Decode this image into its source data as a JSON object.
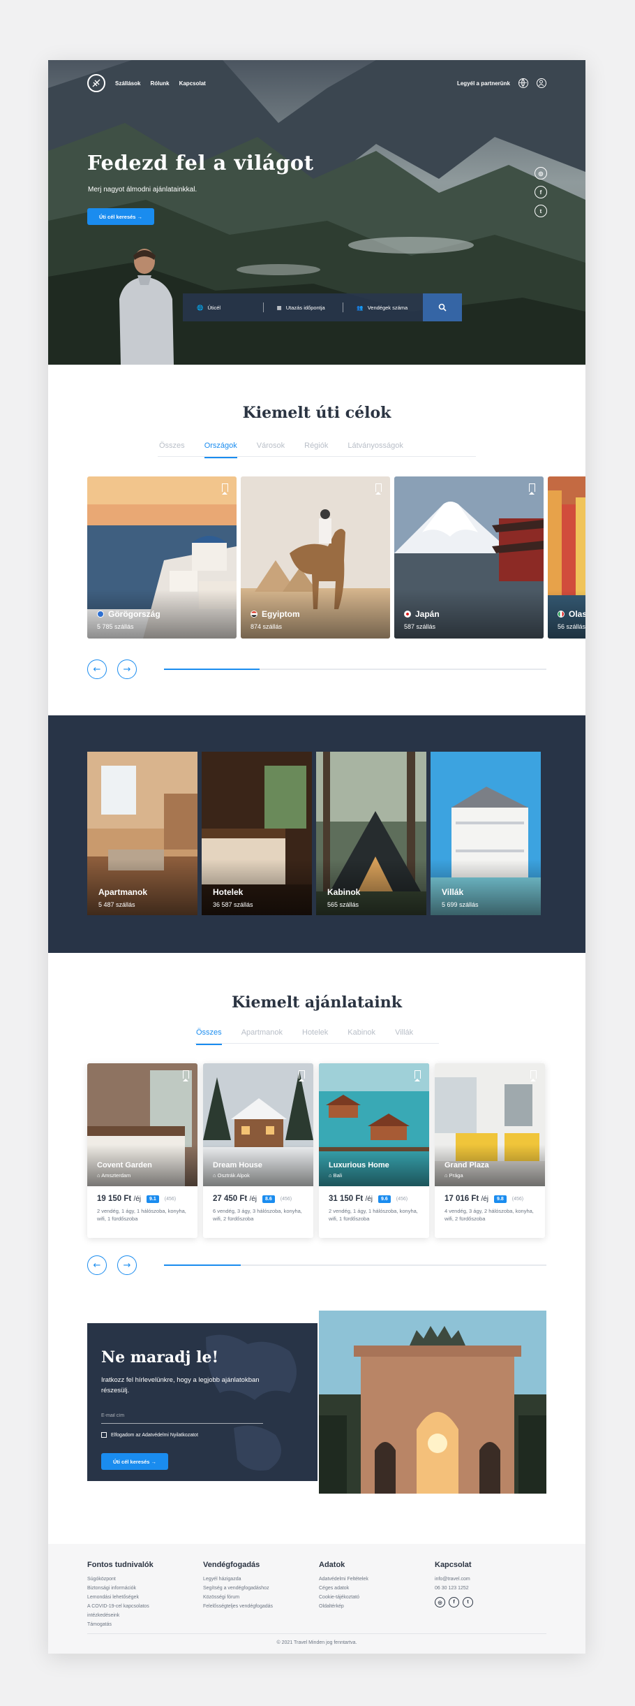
{
  "nav": {
    "links": [
      "Szállások",
      "Rólunk",
      "Kapcsolat"
    ],
    "partner": "Legyél a partnerünk"
  },
  "hero": {
    "title": "Fedezd fel a világot",
    "subtitle": "Merj nagyot álmodni ajánlatainkkal.",
    "cta": "Úti cél keresés →",
    "social": [
      "instagram-icon",
      "facebook-icon",
      "twitter-icon"
    ]
  },
  "search": {
    "destination": "Úticél",
    "dates": "Utazás időpontja",
    "guests": "Vendégek száma"
  },
  "destinations": {
    "title": "Kiemelt úti célok",
    "tabs": [
      "Összes",
      "Országok",
      "Városok",
      "Régiók",
      "Látványosságok"
    ],
    "active_tab": "Országok",
    "progress": 0.25,
    "cards": [
      {
        "name": "Görögország",
        "count": "5 785 szállás"
      },
      {
        "name": "Egyiptom",
        "count": "874 szállás"
      },
      {
        "name": "Japán",
        "count": "587 szállás"
      },
      {
        "name": "Olasz",
        "count": "56 szállás"
      }
    ]
  },
  "categories": [
    {
      "name": "Apartmanok",
      "count": "5 487 szállás"
    },
    {
      "name": "Hotelek",
      "count": "36 587 szállás"
    },
    {
      "name": "Kabinok",
      "count": "565 szállás"
    },
    {
      "name": "Villák",
      "count": "5 699 szállás"
    }
  ],
  "offers": {
    "title": "Kiemelt ajánlataink",
    "tabs": [
      "Összes",
      "Apartmanok",
      "Hotelek",
      "Kabinok",
      "Villák"
    ],
    "active_tab": "Összes",
    "progress": 0.25,
    "cards": [
      {
        "name": "Covent Garden",
        "location": "Amszterdam",
        "price": "19 150 Ft",
        "per": "/éj",
        "rating": "9.1",
        "reviews": "(456)",
        "desc": "2 vendég, 1 ágy, 1 hálószoba, konyha, wifi, 1 fürdőszoba"
      },
      {
        "name": "Dream House",
        "location": "Osztrák Alpok",
        "price": "27 450 Ft",
        "per": "/éj",
        "rating": "8.6",
        "reviews": "(456)",
        "desc": "6 vendég, 3 ágy, 3 hálószoba, konyha, wifi, 2 fürdőszoba"
      },
      {
        "name": "Luxurious Home",
        "location": "Bali",
        "price": "31 150 Ft",
        "per": "/éj",
        "rating": "9.6",
        "reviews": "(456)",
        "desc": "2 vendég, 1 ágy, 1 hálószoba, konyha, wifi, 1 fürdőszoba"
      },
      {
        "name": "Grand Plaza",
        "location": "Prága",
        "price": "17 016 Ft",
        "per": "/éj",
        "rating": "9.8",
        "reviews": "(456)",
        "desc": "4 vendég, 3 ágy, 2 hálószoba, konyha, wifi, 2 fürdőszoba"
      }
    ]
  },
  "newsletter": {
    "title": "Ne maradj le!",
    "subtitle": "Iratkozz fel hírlevelünkre, hogy a legjobb ajánlatokban részesülj.",
    "email_placeholder": "E-mail cím",
    "consent": "Elfogadom az Adatvédelmi Nyilatkozatot",
    "cta": "Úti cél keresés →"
  },
  "footer": {
    "columns": [
      {
        "title": "Fontos tudnivalók",
        "links": [
          "Súgóközpont",
          "Biztonsági információk",
          "Lemondási lehetőségek",
          "A COVID-19-cel kapcsolatos intézkedéseink",
          "Támogatás"
        ]
      },
      {
        "title": "Vendégfogadás",
        "links": [
          "Legyél házigazda",
          "Segítség a vendégfogadáshoz",
          "Közösségi fórum",
          "Felelősségteljes vendégfogadás"
        ]
      },
      {
        "title": "Adatok",
        "links": [
          "Adatvédelmi Feltételek",
          "Céges adatok",
          "Cookie-tájékoztató",
          "Oldaltérkép"
        ]
      },
      {
        "title": "Kapcsolat",
        "links": [
          "info@travel.com",
          "06 30 123 1252"
        ]
      }
    ],
    "copyright": "© 2021 Travel Minden jog fenntartva."
  },
  "colors": {
    "accent": "#1a8cef",
    "dark": "#283447",
    "text": "#2b3442"
  }
}
